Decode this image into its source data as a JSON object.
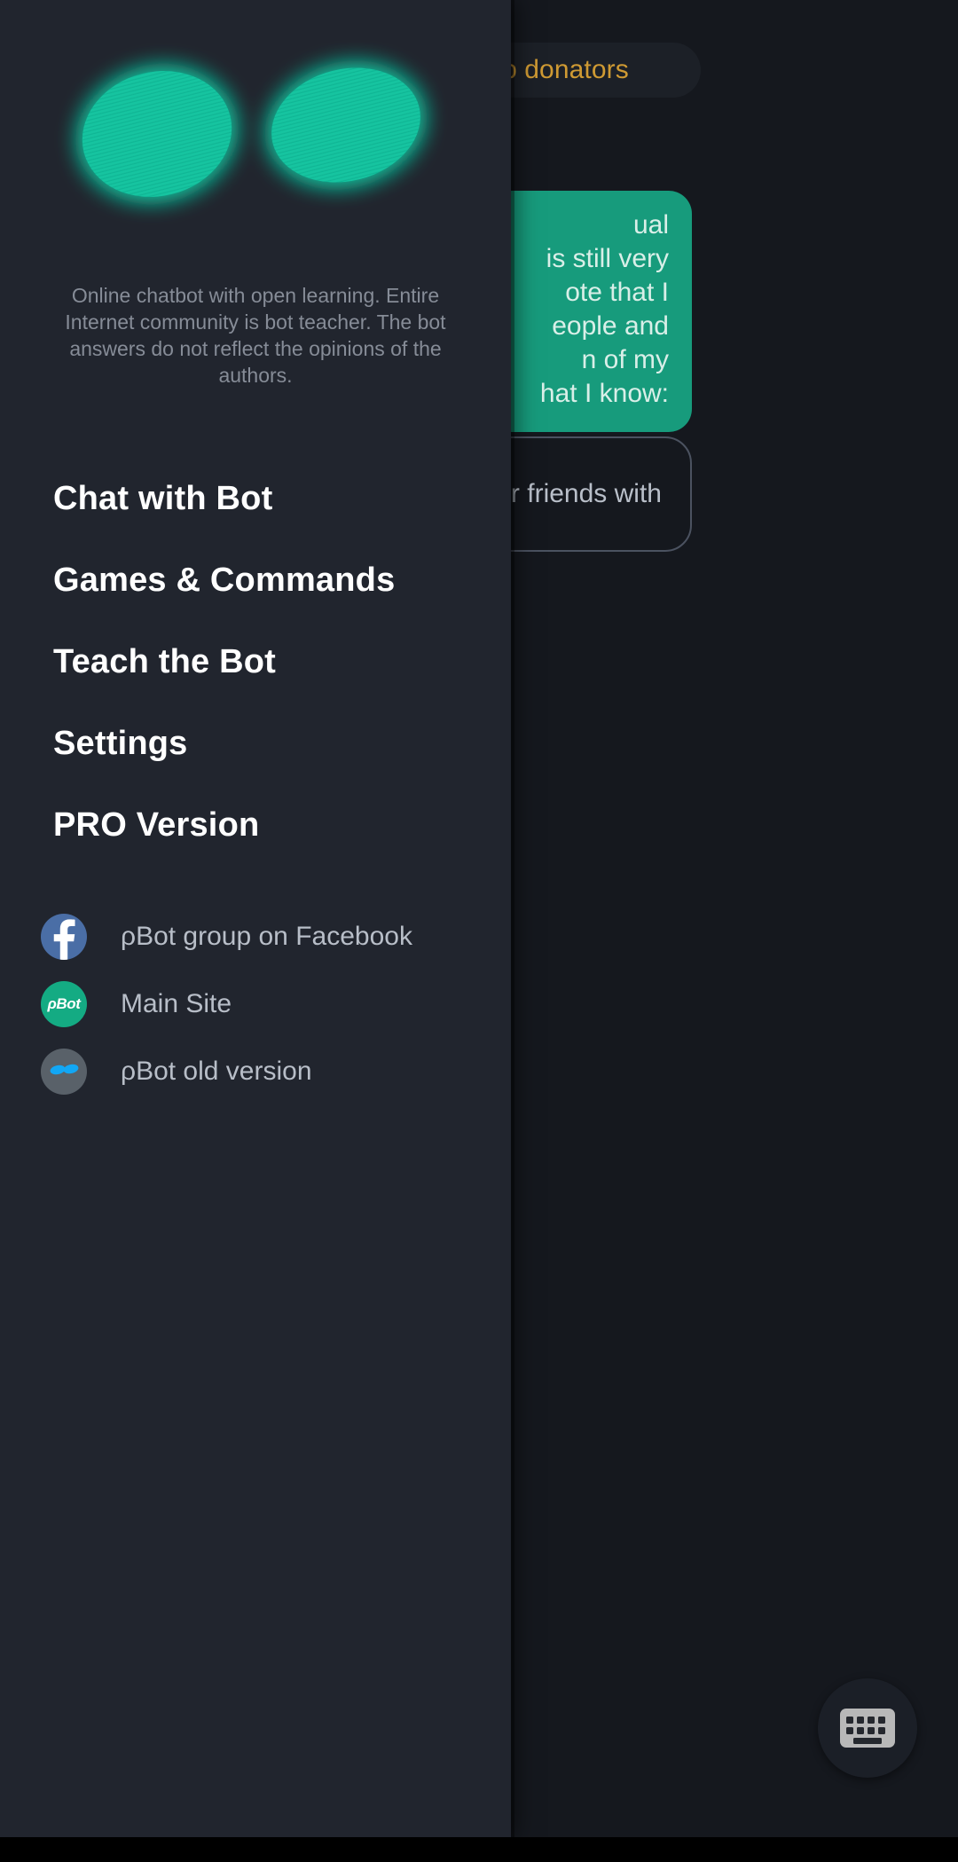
{
  "colors": {
    "drawer_bg": "#21252e",
    "chat_bg": "#15181e",
    "accent_green": "#14c4a0",
    "bubble_green": "#179b7c",
    "donators_gold": "#cf9a33",
    "facebook_blue": "#4a6ea6",
    "pbot_green": "#14ab83",
    "old_bot_gray": "#596169",
    "eye_glow": "#0fd0a8",
    "menu_text": "#ffffff",
    "muted_text": "#868c97",
    "link_text": "#b8bec8"
  },
  "drawer": {
    "logo": {
      "name": "bot-eyes-logo",
      "left_eye": "teal-oval",
      "right_eye": "teal-oval"
    },
    "tagline": "Online chatbot with open learning. Entire Internet community is bot teacher. The bot answers do not reflect the opinions of the authors.",
    "menu": [
      {
        "label": "Chat with Bot",
        "name": "menu-item-chat-with-bot"
      },
      {
        "label": "Games & Commands",
        "name": "menu-item-games-commands"
      },
      {
        "label": "Teach the Bot",
        "name": "menu-item-teach-the-bot"
      },
      {
        "label": "Settings",
        "name": "menu-item-settings"
      },
      {
        "label": "PRO Version",
        "name": "menu-item-pro-version"
      }
    ],
    "links": [
      {
        "label": "ρBot group on Facebook",
        "icon": "facebook-icon",
        "icon_text": "f"
      },
      {
        "label": "Main Site",
        "icon": "pbot-logo-icon",
        "icon_text": "ρBot"
      },
      {
        "label": "ρBot old version",
        "icon": "old-bot-eyes-icon",
        "icon_text": ""
      }
    ]
  },
  "chat": {
    "donators_button": "Top donators",
    "bot_bubble_lines": [
      "ual",
      "is still very",
      "ote that I",
      "eople and",
      "n of my",
      "hat I know:"
    ],
    "user_bubble_text": "ty or friends with",
    "keyboard_fab": "keyboard-icon"
  }
}
